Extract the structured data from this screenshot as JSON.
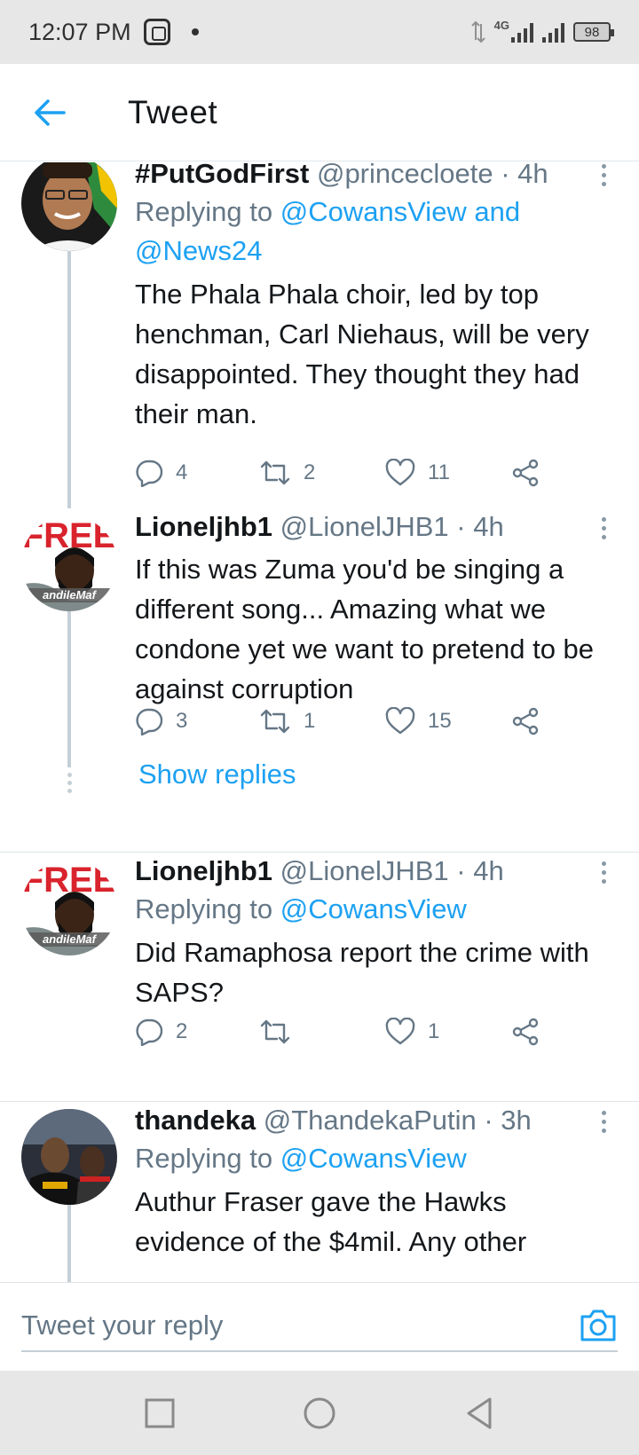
{
  "status_bar": {
    "time": "12:07 PM",
    "network": "4G",
    "battery": "98"
  },
  "header": {
    "title": "Tweet"
  },
  "tweets": [
    {
      "name": "#PutGodFirst",
      "handle": "@princecloete",
      "time": "· 4h",
      "replying_prefix": "Replying to ",
      "replying_to": "@CowansView and @News24",
      "text": "The Phala Phala choir, led by top henchman, Carl Niehaus, will be very disappointed. They thought they had their man.",
      "replies": "4",
      "retweets": "2",
      "likes": "11"
    },
    {
      "name": "Lioneljhb1",
      "handle": "@LionelJHB1",
      "time": "· 4h",
      "text": "If this was Zuma you'd be singing a different song...  Amazing what we condone yet we want to pretend to be against corruption",
      "replies": "3",
      "retweets": "1",
      "likes": "15",
      "show_replies": "Show replies"
    },
    {
      "name": "Lioneljhb1",
      "handle": "@LionelJHB1",
      "time": "· 4h",
      "replying_prefix": "Replying to ",
      "replying_to": "@CowansView",
      "text": "Did Ramaphosa report the crime with SAPS?",
      "replies": "2",
      "retweets": "",
      "likes": "1"
    },
    {
      "name": "thandeka",
      "handle": "@ThandekaPutin",
      "time": "· 3h",
      "replying_prefix": "Replying to ",
      "replying_to": "@CowansView",
      "text": "Authur Fraser gave the Hawks evidence of the $4mil. Any other"
    }
  ],
  "avatar_text": {
    "free_badge": "FREE",
    "caption": "andileMaf"
  },
  "reply_bar": {
    "placeholder": "Tweet your reply"
  },
  "colors": {
    "accent": "#1da1f2",
    "muted": "#657786",
    "text": "#14171a"
  },
  "icons": [
    "back-arrow-icon",
    "reply-icon",
    "retweet-icon",
    "like-icon",
    "share-icon",
    "more-icon",
    "camera-icon",
    "nav-square-icon",
    "nav-circle-icon",
    "nav-back-icon"
  ]
}
